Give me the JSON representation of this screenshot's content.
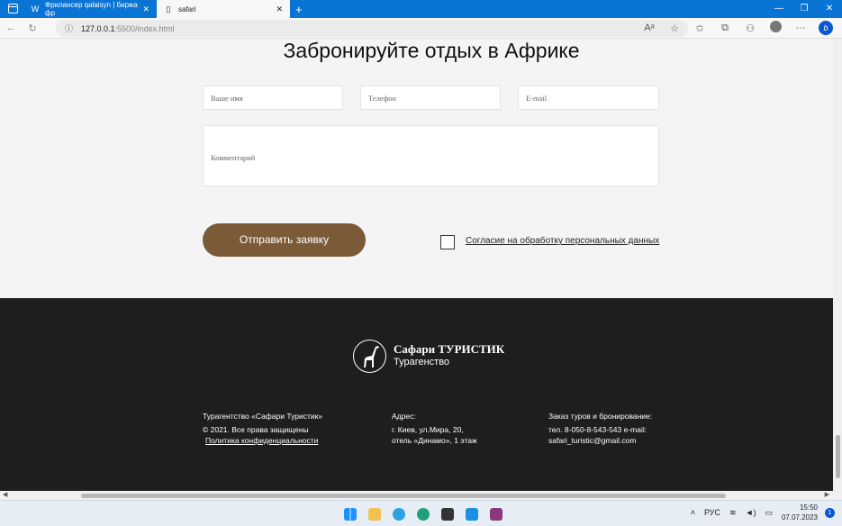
{
  "browser": {
    "tabs": [
      {
        "label": "Фрилансер qalaisyn | биржа фр",
        "icon": "w-icon"
      },
      {
        "label": "safari",
        "icon": "page-icon"
      }
    ],
    "url_host": "127.0.0.1",
    "url_path": ":5500/index.html"
  },
  "booking": {
    "title": "Забронируйте отдых в Африке",
    "name_placeholder": "Ваше имя",
    "phone_placeholder": "Телефон",
    "email_placeholder": "E-mail",
    "comment_placeholder": "Комментарий",
    "submit_label": "Отправить заявку",
    "consent_label": "Согласие на обработку персональных данных"
  },
  "footer": {
    "brand_name": "Сафари ТУРИСТИК",
    "brand_sub": "Турагенство",
    "col1": {
      "title": "Турагентство «Сафари Туристик»",
      "line1": "© 2021. Все права защищены",
      "link": "Политика конфиденциальности"
    },
    "col2": {
      "title": "Адрес:",
      "line1": "г. Киев, ул.Мира, 20,",
      "line2": "отель «Динамо», 1 этаж"
    },
    "col3": {
      "title": "Заказ туров и бронирование:",
      "line1": "тел. 8-050-8-543-543 e-mail:",
      "line2": "safari_turistic@gmail.com"
    }
  },
  "taskbar": {
    "lang": "РУС",
    "time": "15:50",
    "date": "07.07.2023",
    "notifications": "1"
  },
  "colors": {
    "accent_button": "#7b5a38",
    "footer_bg": "#1e1e1e",
    "tabbar": "#0a74d4"
  }
}
